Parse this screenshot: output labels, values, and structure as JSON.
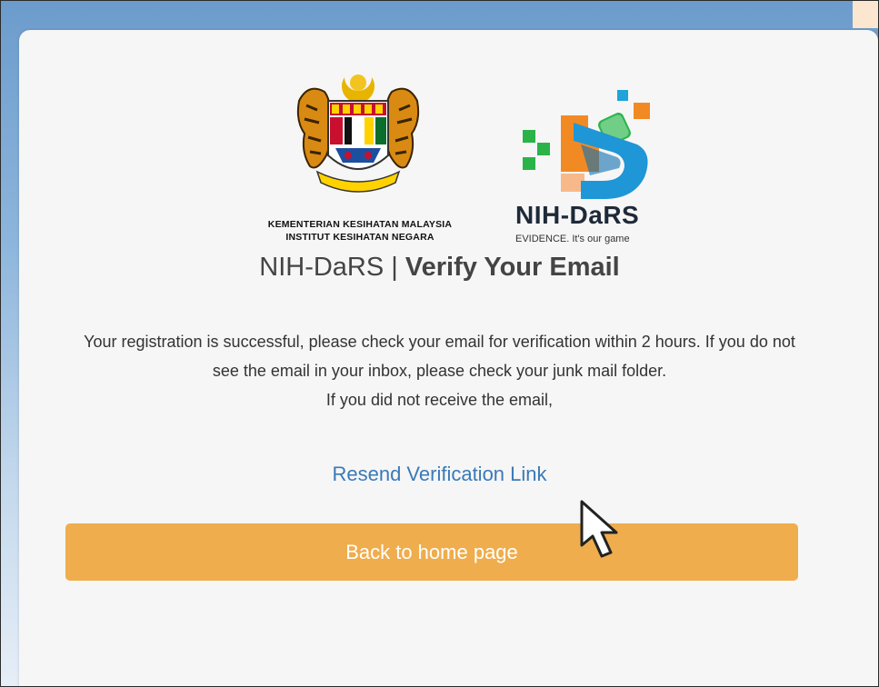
{
  "header": {
    "moh_line1": "KEMENTERIAN KESIHATAN MALAYSIA",
    "moh_line2": "INSTITUT KESIHATAN NEGARA",
    "brand_name": "NIH-DaRS",
    "brand_tagline": "EVIDENCE. It's our game"
  },
  "title": {
    "prefix": "NIH-DaRS | ",
    "bold": "Verify Your Email"
  },
  "message": {
    "line1": "Your registration is successful, please check your email for verification within 2 hours. If you do not see the email in your inbox, please check your junk mail folder.",
    "line2": "If you did not receive the email,"
  },
  "actions": {
    "resend_label": "Resend Verification Link",
    "home_label": "Back to home page"
  },
  "colors": {
    "accent_button": "#efad4d",
    "link": "#3a7ab8",
    "background_top": "#6c9ccc"
  }
}
